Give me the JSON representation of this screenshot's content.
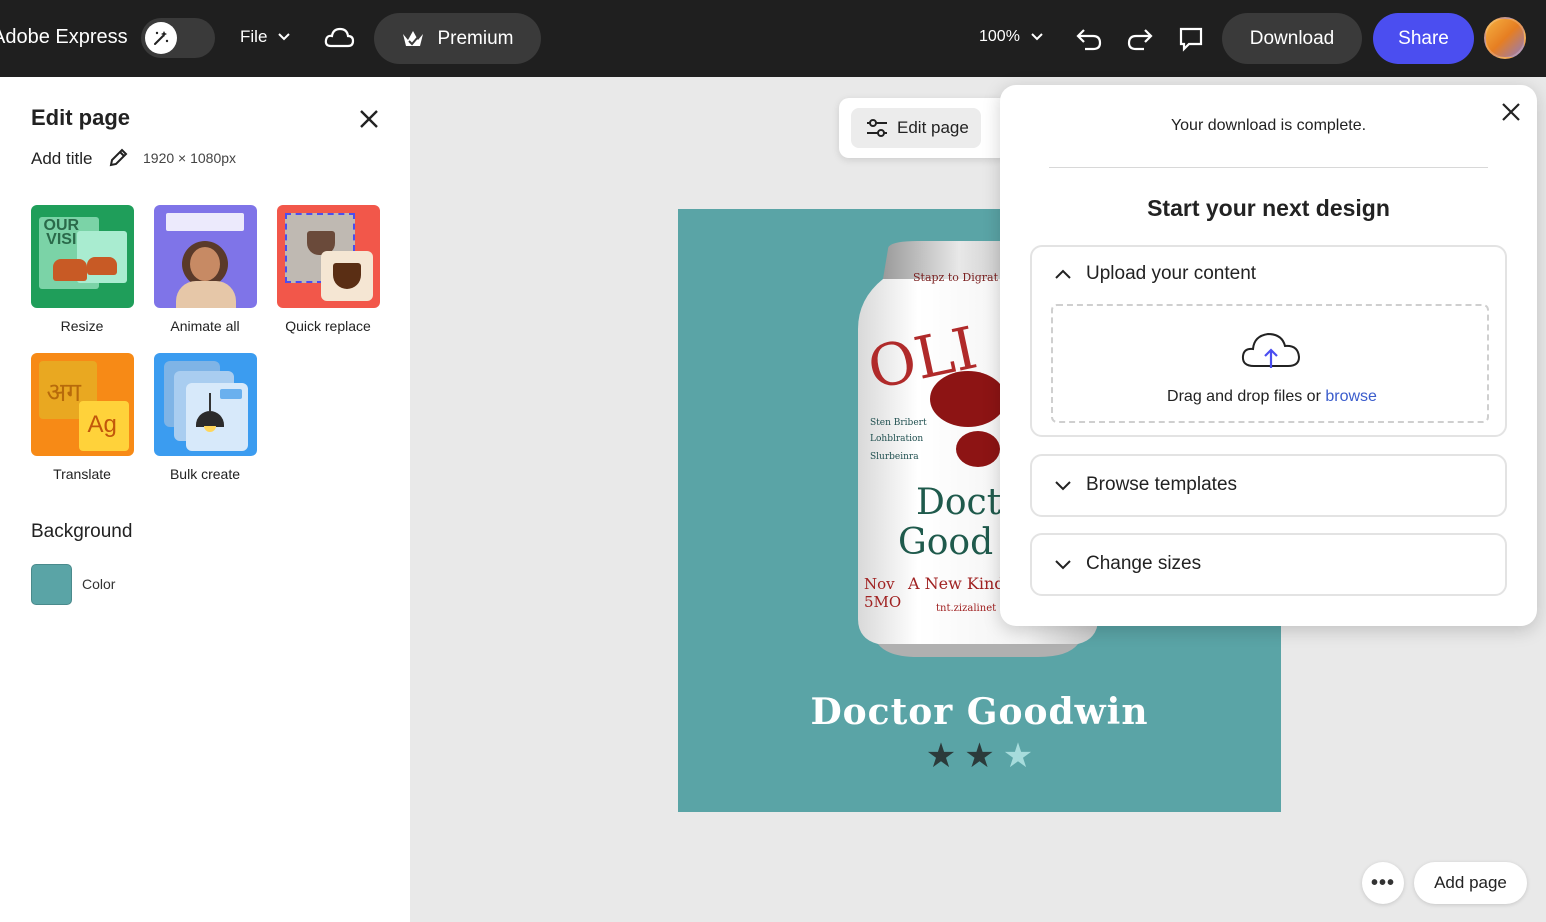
{
  "topbar": {
    "app_name": "Adobe Express",
    "file_label": "File",
    "premium_label": "Premium",
    "zoom_label": "100%",
    "download_label": "Download",
    "share_label": "Share"
  },
  "left_panel": {
    "title": "Edit page",
    "add_title": "Add title",
    "dimensions": "1920 × 1080px",
    "tools": [
      {
        "label": "Resize",
        "icon": "resize-tool-thumbnail"
      },
      {
        "label": "Animate all",
        "icon": "animate-all-thumbnail"
      },
      {
        "label": "Quick replace",
        "icon": "quick-replace-thumbnail"
      },
      {
        "label": "Translate",
        "icon": "translate-thumbnail"
      },
      {
        "label": "Bulk create",
        "icon": "bulk-create-thumbnail"
      }
    ],
    "background_title": "Background",
    "color_label": "Color",
    "background_color": "#5aa4a6"
  },
  "canvas": {
    "edit_page_label": "Edit page",
    "product_name": "Doctor Goodwin",
    "rating": {
      "value": 2,
      "max": 3
    },
    "accent": "#5aa4a6"
  },
  "popup": {
    "message": "Your download is complete.",
    "heading": "Start your next design",
    "upload": {
      "title": "Upload your content",
      "drop_text": "Drag and drop files or ",
      "browse_link": "browse"
    },
    "browse_templates": "Browse templates",
    "change_sizes": "Change sizes"
  },
  "footer": {
    "more_label": "•••",
    "add_page_label": "Add page"
  }
}
